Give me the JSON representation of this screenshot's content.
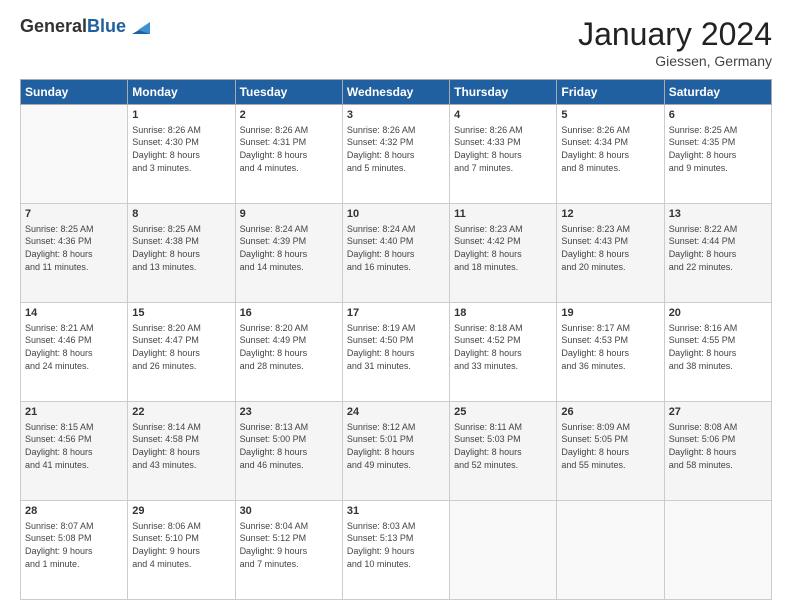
{
  "logo": {
    "general": "General",
    "blue": "Blue"
  },
  "header": {
    "month": "January 2024",
    "location": "Giessen, Germany"
  },
  "weekdays": [
    "Sunday",
    "Monday",
    "Tuesday",
    "Wednesday",
    "Thursday",
    "Friday",
    "Saturday"
  ],
  "weeks": [
    [
      {
        "day": "",
        "info": ""
      },
      {
        "day": "1",
        "info": "Sunrise: 8:26 AM\nSunset: 4:30 PM\nDaylight: 8 hours\nand 3 minutes."
      },
      {
        "day": "2",
        "info": "Sunrise: 8:26 AM\nSunset: 4:31 PM\nDaylight: 8 hours\nand 4 minutes."
      },
      {
        "day": "3",
        "info": "Sunrise: 8:26 AM\nSunset: 4:32 PM\nDaylight: 8 hours\nand 5 minutes."
      },
      {
        "day": "4",
        "info": "Sunrise: 8:26 AM\nSunset: 4:33 PM\nDaylight: 8 hours\nand 7 minutes."
      },
      {
        "day": "5",
        "info": "Sunrise: 8:26 AM\nSunset: 4:34 PM\nDaylight: 8 hours\nand 8 minutes."
      },
      {
        "day": "6",
        "info": "Sunrise: 8:25 AM\nSunset: 4:35 PM\nDaylight: 8 hours\nand 9 minutes."
      }
    ],
    [
      {
        "day": "7",
        "info": "Sunrise: 8:25 AM\nSunset: 4:36 PM\nDaylight: 8 hours\nand 11 minutes."
      },
      {
        "day": "8",
        "info": "Sunrise: 8:25 AM\nSunset: 4:38 PM\nDaylight: 8 hours\nand 13 minutes."
      },
      {
        "day": "9",
        "info": "Sunrise: 8:24 AM\nSunset: 4:39 PM\nDaylight: 8 hours\nand 14 minutes."
      },
      {
        "day": "10",
        "info": "Sunrise: 8:24 AM\nSunset: 4:40 PM\nDaylight: 8 hours\nand 16 minutes."
      },
      {
        "day": "11",
        "info": "Sunrise: 8:23 AM\nSunset: 4:42 PM\nDaylight: 8 hours\nand 18 minutes."
      },
      {
        "day": "12",
        "info": "Sunrise: 8:23 AM\nSunset: 4:43 PM\nDaylight: 8 hours\nand 20 minutes."
      },
      {
        "day": "13",
        "info": "Sunrise: 8:22 AM\nSunset: 4:44 PM\nDaylight: 8 hours\nand 22 minutes."
      }
    ],
    [
      {
        "day": "14",
        "info": "Sunrise: 8:21 AM\nSunset: 4:46 PM\nDaylight: 8 hours\nand 24 minutes."
      },
      {
        "day": "15",
        "info": "Sunrise: 8:20 AM\nSunset: 4:47 PM\nDaylight: 8 hours\nand 26 minutes."
      },
      {
        "day": "16",
        "info": "Sunrise: 8:20 AM\nSunset: 4:49 PM\nDaylight: 8 hours\nand 28 minutes."
      },
      {
        "day": "17",
        "info": "Sunrise: 8:19 AM\nSunset: 4:50 PM\nDaylight: 8 hours\nand 31 minutes."
      },
      {
        "day": "18",
        "info": "Sunrise: 8:18 AM\nSunset: 4:52 PM\nDaylight: 8 hours\nand 33 minutes."
      },
      {
        "day": "19",
        "info": "Sunrise: 8:17 AM\nSunset: 4:53 PM\nDaylight: 8 hours\nand 36 minutes."
      },
      {
        "day": "20",
        "info": "Sunrise: 8:16 AM\nSunset: 4:55 PM\nDaylight: 8 hours\nand 38 minutes."
      }
    ],
    [
      {
        "day": "21",
        "info": "Sunrise: 8:15 AM\nSunset: 4:56 PM\nDaylight: 8 hours\nand 41 minutes."
      },
      {
        "day": "22",
        "info": "Sunrise: 8:14 AM\nSunset: 4:58 PM\nDaylight: 8 hours\nand 43 minutes."
      },
      {
        "day": "23",
        "info": "Sunrise: 8:13 AM\nSunset: 5:00 PM\nDaylight: 8 hours\nand 46 minutes."
      },
      {
        "day": "24",
        "info": "Sunrise: 8:12 AM\nSunset: 5:01 PM\nDaylight: 8 hours\nand 49 minutes."
      },
      {
        "day": "25",
        "info": "Sunrise: 8:11 AM\nSunset: 5:03 PM\nDaylight: 8 hours\nand 52 minutes."
      },
      {
        "day": "26",
        "info": "Sunrise: 8:09 AM\nSunset: 5:05 PM\nDaylight: 8 hours\nand 55 minutes."
      },
      {
        "day": "27",
        "info": "Sunrise: 8:08 AM\nSunset: 5:06 PM\nDaylight: 8 hours\nand 58 minutes."
      }
    ],
    [
      {
        "day": "28",
        "info": "Sunrise: 8:07 AM\nSunset: 5:08 PM\nDaylight: 9 hours\nand 1 minute."
      },
      {
        "day": "29",
        "info": "Sunrise: 8:06 AM\nSunset: 5:10 PM\nDaylight: 9 hours\nand 4 minutes."
      },
      {
        "day": "30",
        "info": "Sunrise: 8:04 AM\nSunset: 5:12 PM\nDaylight: 9 hours\nand 7 minutes."
      },
      {
        "day": "31",
        "info": "Sunrise: 8:03 AM\nSunset: 5:13 PM\nDaylight: 9 hours\nand 10 minutes."
      },
      {
        "day": "",
        "info": ""
      },
      {
        "day": "",
        "info": ""
      },
      {
        "day": "",
        "info": ""
      }
    ]
  ]
}
